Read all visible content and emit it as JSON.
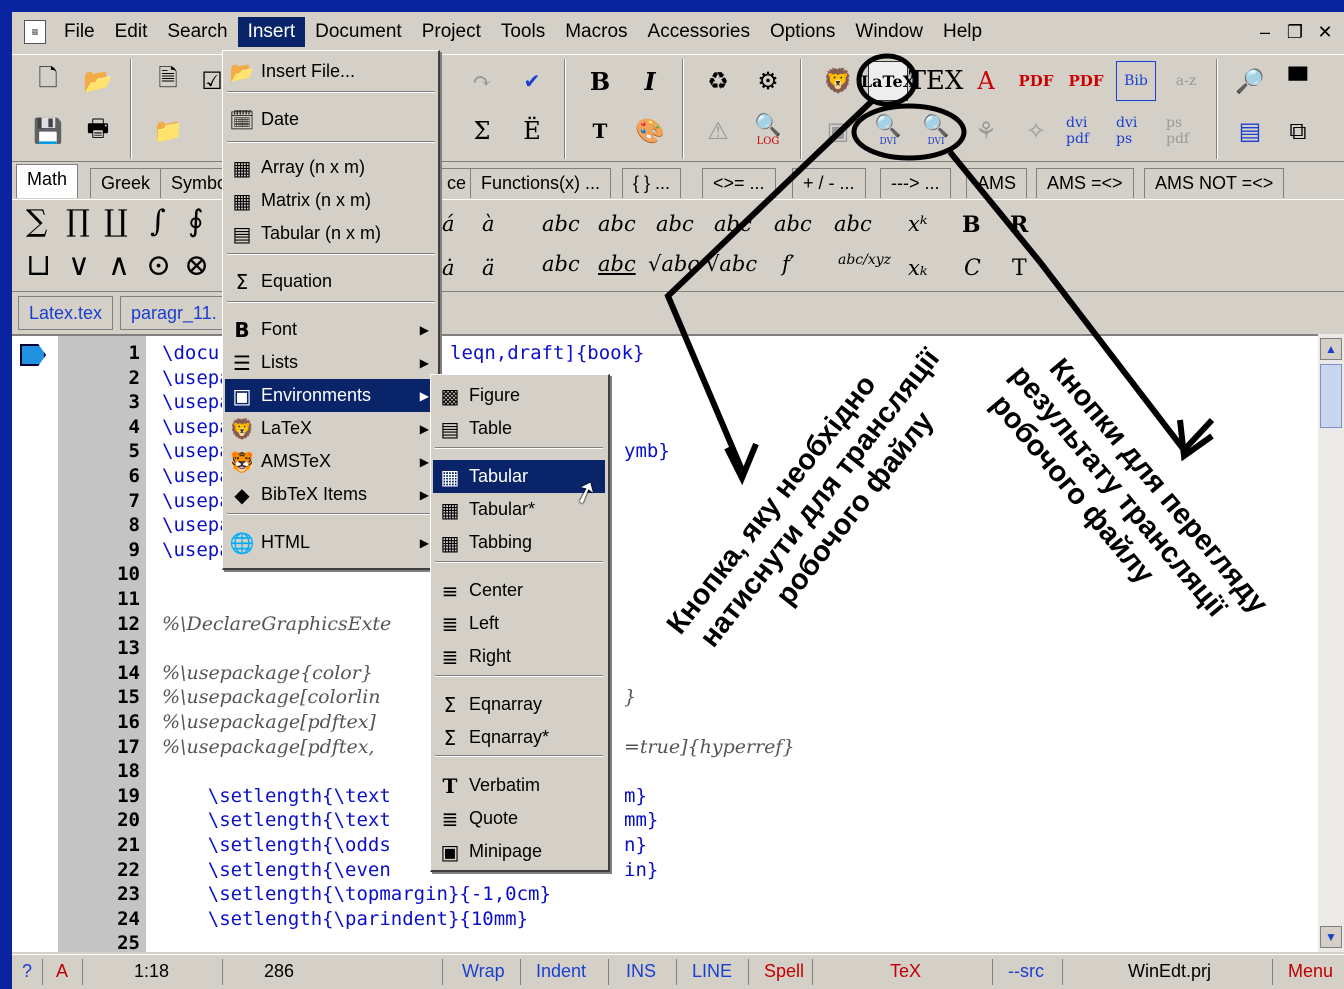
{
  "menubar": {
    "items": [
      "File",
      "Edit",
      "Search",
      "Insert",
      "Document",
      "Project",
      "Tools",
      "Macros",
      "Accessories",
      "Options",
      "Window",
      "Help"
    ],
    "active": "Insert"
  },
  "toolbar": {
    "latex_label": "LaTeX",
    "tex_label": "TEX",
    "bib_label": "Bib",
    "dvi_pdf_label": "dvi pdf",
    "dvi_ps_label": "dvi ps",
    "ps_pdf_label": "ps pdf",
    "log_label": "LOG",
    "dvi_label": "DVI"
  },
  "tabs": [
    "Math",
    "Greek",
    "Symbo",
    "ce",
    "Functions(x) ...",
    "{ } ...",
    "<>= ...",
    "+ / - ...",
    "---> ...",
    "AMS",
    "AMS =<>",
    "AMS NOT =<>"
  ],
  "file_tabs": [
    "Latex.tex",
    "paragr_11."
  ],
  "insert_menu": [
    {
      "label": "Insert File...",
      "icon": "folder-open-icon",
      "arrow": false
    },
    {
      "label": "Date",
      "icon": "calendar-icon",
      "arrow": false
    },
    {
      "label": "Array (n x m)",
      "icon": "grid-icon",
      "arrow": false
    },
    {
      "label": "Matrix (n x m)",
      "icon": "grid-icon",
      "arrow": false
    },
    {
      "label": "Tabular (n x m)",
      "icon": "table-icon",
      "arrow": false
    },
    {
      "label": "Equation",
      "icon": "sigma-icon",
      "arrow": false
    },
    {
      "label": "Font",
      "icon": "bold-icon",
      "arrow": true
    },
    {
      "label": "Lists",
      "icon": "list-icon",
      "arrow": true
    },
    {
      "label": "Environments",
      "icon": "environment-icon",
      "arrow": true
    },
    {
      "label": "LaTeX",
      "icon": "latex-lion-icon",
      "arrow": true
    },
    {
      "label": "AMSTeX",
      "icon": "amstex-lion-icon",
      "arrow": true
    },
    {
      "label": "BibTeX Items",
      "icon": "bibtex-icon",
      "arrow": true
    },
    {
      "label": "HTML",
      "icon": "html-globe-icon",
      "arrow": true
    }
  ],
  "environments_menu": [
    {
      "label": "Figure",
      "icon": "figure-icon"
    },
    {
      "label": "Table",
      "icon": "table-icon"
    },
    {
      "label": "Tabular",
      "icon": "tabular-icon"
    },
    {
      "label": "Tabular*",
      "icon": "tabular-icon"
    },
    {
      "label": "Tabbing",
      "icon": "tabbing-icon"
    },
    {
      "label": "Center",
      "icon": "align-center-icon"
    },
    {
      "label": "Left",
      "icon": "align-left-icon"
    },
    {
      "label": "Right",
      "icon": "align-right-icon"
    },
    {
      "label": "Eqnarray",
      "icon": "sigma-icon"
    },
    {
      "label": "Eqnarray*",
      "icon": "sigma-icon"
    },
    {
      "label": "Verbatim",
      "icon": "verbatim-icon"
    },
    {
      "label": "Quote",
      "icon": "quote-icon"
    },
    {
      "label": "Minipage",
      "icon": "minipage-icon"
    }
  ],
  "editor": {
    "lines": [
      {
        "n": "1",
        "a": "\\docu",
        "b": "leqn,draft]{book}"
      },
      {
        "n": "2",
        "a": "\\usepa",
        "b": ""
      },
      {
        "n": "3",
        "a": "\\usepa",
        "b": ""
      },
      {
        "n": "4",
        "a": "\\usepa",
        "b": ""
      },
      {
        "n": "5",
        "a": "\\usepa",
        "b": "ymb}"
      },
      {
        "n": "6",
        "a": "\\usepa",
        "b": ""
      },
      {
        "n": "7",
        "a": "\\usepa",
        "b": ""
      },
      {
        "n": "8",
        "a": "\\usepa",
        "b": ""
      },
      {
        "n": "9",
        "a": "\\usepa",
        "b": ""
      },
      {
        "n": "10",
        "a": "",
        "b": ""
      },
      {
        "n": "11",
        "a": "",
        "b": ""
      },
      {
        "n": "12",
        "a": "%\\DeclareGraphicsExte",
        "b": ""
      },
      {
        "n": "13",
        "a": "",
        "b": ""
      },
      {
        "n": "14",
        "a": "%\\usepackage{color}",
        "b": ""
      },
      {
        "n": "15",
        "a": "%\\usepackage[colorlin",
        "b": "}"
      },
      {
        "n": "16",
        "a": "%\\usepackage[pdftex]",
        "b": ""
      },
      {
        "n": "17",
        "a": "%\\usepackage[pdftex,",
        "b": "=true]{hyperref}"
      },
      {
        "n": "18",
        "a": "",
        "b": ""
      },
      {
        "n": "19",
        "a": "    \\setlength{\\text",
        "b": "m}"
      },
      {
        "n": "20",
        "a": "    \\setlength{\\text",
        "b": "mm}"
      },
      {
        "n": "21",
        "a": "    \\setlength{\\odds",
        "b": "n}"
      },
      {
        "n": "22",
        "a": "    \\setlength{\\even",
        "b": "in}"
      },
      {
        "n": "23",
        "a": "    \\setlength{\\topmargin}{-1,0cm}",
        "b": ""
      },
      {
        "n": "24",
        "a": "    \\setlength{\\parindent}{10mm}",
        "b": ""
      },
      {
        "n": "25",
        "a": "",
        "b": ""
      }
    ]
  },
  "status": {
    "help": "?",
    "mode": "A",
    "position": "1:18",
    "chars": "286",
    "wrap": "Wrap",
    "indent": "Indent",
    "ins": "INS",
    "line": "LINE",
    "spell": "Spell",
    "tex": "TeX",
    "src": "--src",
    "project": "WinEdt.prj",
    "menu": "Menu"
  },
  "annotations": {
    "left_lines": [
      "Кнопка, яку необхідно",
      "натиснути для трансляції",
      "робочого файлу"
    ],
    "right_lines": [
      "Кнопки для перегляду",
      "результату трансляції",
      "робочого файлу"
    ]
  },
  "colors": {
    "menu_highlight": "#0a246a",
    "window_bg": "#d4d0c8",
    "keyword": "#0a10c8",
    "status_blue": "#1a3fd0",
    "status_red": "#c00000"
  }
}
